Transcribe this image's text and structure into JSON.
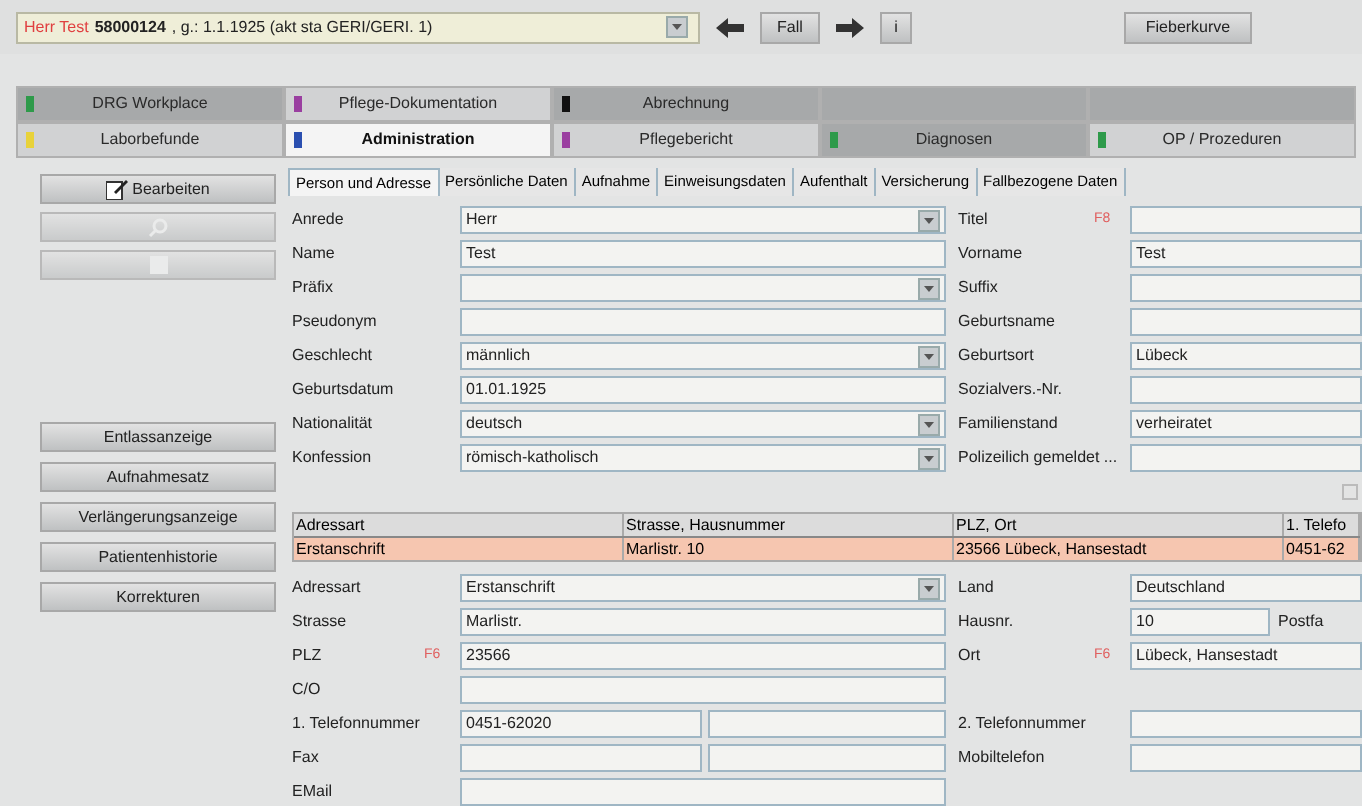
{
  "header": {
    "patient_name": "Herr Test",
    "case_number": "58000124",
    "patient_info": ", g.: 1.1.1925 (akt sta GERI/GERI. 1)",
    "case_button": "Fall",
    "info_button": "i",
    "chart_button": "Fieberkurve"
  },
  "module_tabs": [
    [
      {
        "label": "DRG Workplace",
        "color": "#2e9a4a",
        "selected": false,
        "dimmed": true
      },
      {
        "label": "Pflege-Dokumentation",
        "color": "#9a3fa0",
        "selected": false,
        "dimmed": false
      },
      {
        "label": "Abrechnung",
        "color": "#111111",
        "selected": false,
        "dimmed": true
      },
      {
        "selected": false,
        "dimmed": true
      },
      {
        "selected": false,
        "dimmed": true
      }
    ],
    [
      {
        "label": "Laborbefunde",
        "color": "#e8d23a",
        "selected": false,
        "dimmed": false
      },
      {
        "label": "Administration",
        "color": "#2a4fb0",
        "selected": true,
        "dimmed": false
      },
      {
        "label": "Pflegebericht",
        "color": "#9a3fa0",
        "selected": false,
        "dimmed": false
      },
      {
        "label": "Diagnosen",
        "color": "#2e9a4a",
        "selected": false,
        "dimmed": true
      },
      {
        "label": "OP / Prozeduren",
        "color": "#2e9a4a",
        "selected": false,
        "dimmed": false
      }
    ]
  ],
  "sidebar": {
    "top_buttons": [
      {
        "label": "Bearbeiten",
        "disabled": false,
        "kind": "edit"
      },
      {
        "disabled": true,
        "kind": "search"
      },
      {
        "disabled": true,
        "kind": "save"
      }
    ],
    "buttons": [
      "Entlassanzeige",
      "Aufnahmesatz",
      "Verlängerungsanzeige",
      "Patientenhistorie",
      "Korrekturen"
    ]
  },
  "sub_tabs": [
    {
      "label": "Person und Adresse",
      "selected": true
    },
    {
      "label": "Persönliche Daten",
      "selected": false
    },
    {
      "label": "Aufnahme",
      "selected": false
    },
    {
      "label": "Einweisungsdaten",
      "selected": false
    },
    {
      "label": "Aufenthalt",
      "selected": false
    },
    {
      "label": "Versicherung",
      "selected": false
    },
    {
      "label": "Fallbezogene Daten",
      "selected": false
    }
  ],
  "person_rows": [
    {
      "left": {
        "label": "Anrede",
        "value": "Herr",
        "kind": "dropdown"
      },
      "right": {
        "label": "Titel",
        "marker": "F8",
        "kind": "text"
      }
    },
    {
      "left": {
        "label": "Name",
        "value": "Test",
        "kind": "text"
      },
      "right": {
        "label": "Vorname",
        "value": "Test",
        "kind": "text"
      }
    },
    {
      "left": {
        "label": "Präfix",
        "kind": "dropdown"
      },
      "right": {
        "label": "Suffix",
        "kind": "text"
      }
    },
    {
      "left": {
        "label": "Pseudonym",
        "kind": "text"
      },
      "right": {
        "label": "Geburtsname",
        "kind": "text"
      }
    },
    {
      "left": {
        "label": "Geschlecht",
        "value": "männlich",
        "kind": "dropdown"
      },
      "right": {
        "label": "Geburtsort",
        "value": "Lübeck",
        "kind": "text"
      }
    },
    {
      "left": {
        "label": "Geburtsdatum",
        "value": "01.01.1925",
        "kind": "text"
      },
      "right": {
        "label": "Sozialvers.-Nr.",
        "kind": "text"
      }
    },
    {
      "left": {
        "label": "Nationalität",
        "value": "deutsch",
        "kind": "dropdown"
      },
      "right": {
        "label": "Familienstand",
        "value": "verheiratet",
        "kind": "text"
      }
    },
    {
      "left": {
        "label": "Konfession",
        "value": "römisch-katholisch",
        "kind": "dropdown"
      },
      "right": {
        "label": "Polizeilich gemeldet ...",
        "kind": "text"
      }
    }
  ],
  "address_option": {
    "checked": false,
    "disabled": true
  },
  "address_table": {
    "columns": [
      "Adressart",
      "Strasse, Hausnummer",
      "PLZ, Ort",
      "1. Telefo"
    ],
    "rows": [
      {
        "cells": [
          "Erstanschrift",
          "Marlistr. 10",
          "23566 Lübeck, Hansestadt",
          "0451-62"
        ],
        "selected": true
      }
    ]
  },
  "address_rows": [
    {
      "left": {
        "label": "Adressart",
        "value": "Erstanschrift",
        "kind": "dropdown"
      },
      "right": {
        "label": "Land",
        "value": "Deutschland",
        "kind": "text"
      }
    },
    {
      "left": {
        "label": "Strasse",
        "value": "Marlistr.",
        "kind": "text"
      },
      "right": {
        "label": "Hausnr.",
        "value": "10",
        "kind": "text",
        "extra_label": "Postfa"
      }
    },
    {
      "left": {
        "label": "PLZ",
        "marker": "F6",
        "value": "23566",
        "kind": "text"
      },
      "right": {
        "label": "Ort",
        "marker": "F6",
        "value": "Lübeck, Hansestadt",
        "kind": "text"
      }
    },
    {
      "left": {
        "label": "C/O",
        "kind": "text"
      }
    },
    {
      "left": {
        "label": "1. Telefonnummer",
        "value": "0451-62020",
        "kind": "double"
      },
      "right": {
        "label": "2. Telefonnummer",
        "kind": "text"
      }
    },
    {
      "left": {
        "label": "Fax",
        "kind": "double"
      },
      "right": {
        "label": "Mobiltelefon",
        "kind": "text"
      }
    },
    {
      "left": {
        "label": "EMail",
        "kind": "text"
      }
    }
  ]
}
